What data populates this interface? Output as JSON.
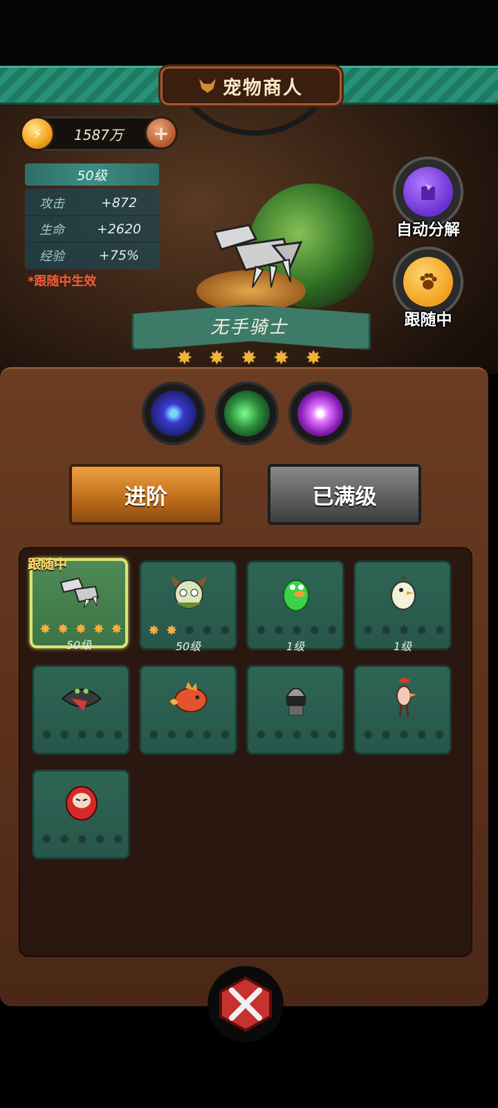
{
  "header": {
    "title": "宠物商人"
  },
  "currency": {
    "value": "1587万",
    "add_label": "+"
  },
  "stats": {
    "level": "50级",
    "rows": [
      {
        "label": "攻击",
        "value": "+872"
      },
      {
        "label": "生命",
        "value": "+2620"
      },
      {
        "label": "经验",
        "value": "+75%"
      }
    ],
    "note": "*跟随中生效"
  },
  "side_buttons": {
    "auto_decompose": "自动分解",
    "following": "跟随中"
  },
  "pet": {
    "name": "无手骑士",
    "stars": 5
  },
  "actions": {
    "advance": "进阶",
    "max_level": "已满级"
  },
  "grid": {
    "follow_tag": "跟随中",
    "pets": [
      {
        "level": "50级",
        "stars": 5
      },
      {
        "level": "50级",
        "stars": 2
      },
      {
        "level": "1级",
        "stars": 0
      },
      {
        "level": "1级",
        "stars": 0
      },
      {
        "level": "",
        "stars": 0
      },
      {
        "level": "",
        "stars": 0
      },
      {
        "level": "",
        "stars": 0
      },
      {
        "level": "",
        "stars": 0
      },
      {
        "level": "",
        "stars": 0
      }
    ]
  },
  "colors": {
    "accent": "#f2b03d",
    "banner": "#27917a",
    "panel": "#5a301b"
  }
}
